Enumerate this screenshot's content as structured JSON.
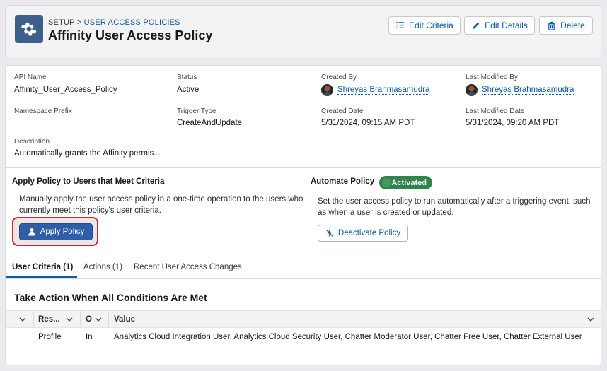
{
  "header": {
    "breadcrumb_root": "SETUP",
    "breadcrumb_sep": ">",
    "breadcrumb_link": "USER ACCESS POLICIES",
    "title": "Affinity User Access Policy",
    "icon": "gear-icon",
    "buttons": {
      "edit_criteria": "Edit Criteria",
      "edit_details": "Edit Details",
      "delete": "Delete"
    }
  },
  "details": {
    "api_name_label": "API Name",
    "api_name": "Affinity_User_Access_Policy",
    "status_label": "Status",
    "status": "Active",
    "created_by_label": "Created By",
    "created_by": "Shreyas Brahmasamudra",
    "last_modified_by_label": "Last Modified By",
    "last_modified_by": "Shreyas Brahmasamudra",
    "namespace_label": "Namespace Prefix",
    "namespace": "",
    "trigger_type_label": "Trigger Type",
    "trigger_type": "CreateAndUpdate",
    "created_date_label": "Created Date",
    "created_date": "5/31/2024, 09:15 AM PDT",
    "last_modified_date_label": "Last Modified Date",
    "last_modified_date": "5/31/2024, 09:20 AM PDT",
    "description_label": "Description",
    "description": "Automatically grants the Affinity permis..."
  },
  "apply": {
    "title": "Apply Policy to Users that Meet Criteria",
    "text_line1": "Manually apply the user access policy in a one-time operation to the users who",
    "text_line2": "currently meet this policy's user criteria.",
    "button": "Apply Policy"
  },
  "automate": {
    "title": "Automate Policy",
    "badge": "Activated",
    "text_line1": "Set the user access policy to run automatically after a triggering event, such",
    "text_line2": "as when a user is created or updated.",
    "button": "Deactivate Policy"
  },
  "tabs": [
    {
      "label": "User Criteria (1)",
      "active": true
    },
    {
      "label": "Actions (1)",
      "active": false
    },
    {
      "label": "Recent User Access Changes",
      "active": false
    }
  ],
  "table": {
    "title": "Take Action When All Conditions Are Met",
    "columns": [
      "Res...",
      "O",
      "Value"
    ],
    "rows": [
      {
        "resource": "Profile",
        "operator": "In",
        "value": "Analytics Cloud Integration User, Analytics Cloud Security User, Chatter Moderator User, Chatter Free User, Chatter External User"
      }
    ]
  },
  "colors": {
    "brand_blue": "#0b5cab",
    "primary_button": "#2e5ea8",
    "activated_green": "#2e844a",
    "highlight_red": "#b5313a"
  }
}
